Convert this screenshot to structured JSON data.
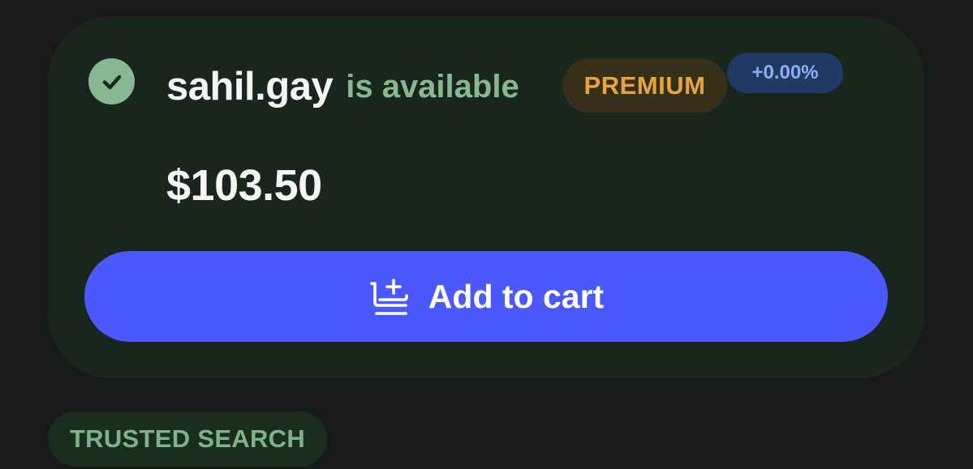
{
  "result": {
    "domain": "sahil.gay",
    "availability_text": "is available",
    "tier_badge": "PREMIUM",
    "price_change": "+0.00%",
    "price": "$103.50",
    "status_icon": "check-circle-icon",
    "colors": {
      "card_background": "#19261e",
      "available_green": "#87b890",
      "premium_orange": "#e7a43e",
      "change_blue": "#8bb0ee",
      "accent_button": "#4a58fe"
    }
  },
  "actions": {
    "add_to_cart_label": "Add to cart",
    "add_to_cart_icon": "cart-add-icon"
  },
  "section": {
    "trusted_search_label": "TRUSTED SEARCH"
  }
}
